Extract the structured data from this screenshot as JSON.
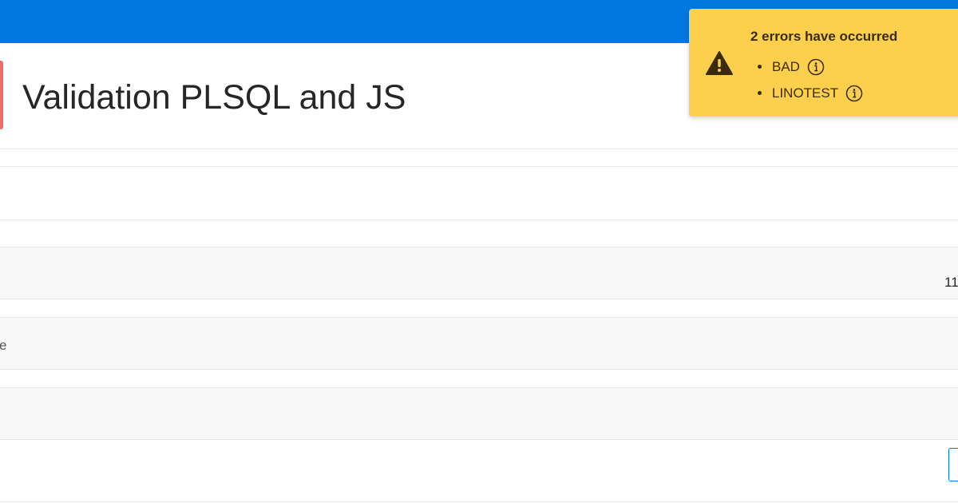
{
  "page": {
    "title": "Validation PLSQL and JS"
  },
  "rows": {
    "clipped_label_1": "e",
    "clipped_value_1": "11"
  },
  "notification": {
    "title": "2 errors have occurred",
    "errors": [
      {
        "label": "BAD"
      },
      {
        "label": "LINOTEST"
      }
    ]
  },
  "colors": {
    "header": "#0076df",
    "accent": "#ec6b6b",
    "warning": "#fccf4d"
  },
  "icons": {
    "alert": "warning-triangle-icon",
    "info": "info-circle-icon"
  }
}
